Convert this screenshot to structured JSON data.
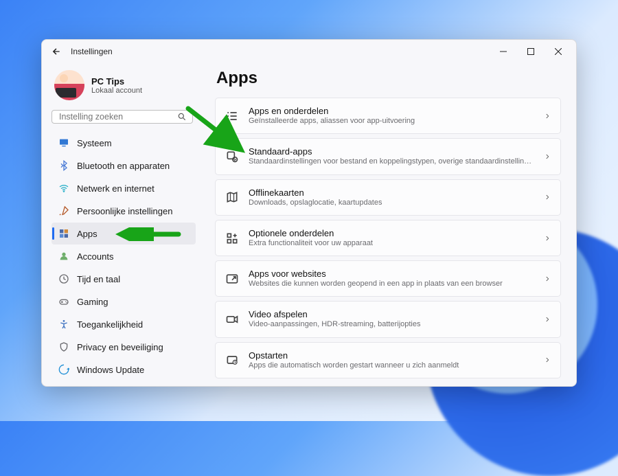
{
  "window": {
    "title": "Instellingen"
  },
  "profile": {
    "name": "PC Tips",
    "subtitle": "Lokaal account"
  },
  "search": {
    "placeholder": "Instelling zoeken"
  },
  "nav": {
    "items": [
      {
        "label": "Systeem",
        "icon": "monitor",
        "color": "#3178d4"
      },
      {
        "label": "Bluetooth en apparaten",
        "icon": "bluetooth",
        "color": "#4b7bd6"
      },
      {
        "label": "Netwerk en internet",
        "icon": "wifi",
        "color": "#2cb1c9"
      },
      {
        "label": "Persoonlijke instellingen",
        "icon": "brush",
        "color": "#b55a2a"
      },
      {
        "label": "Apps",
        "icon": "apps",
        "color": "#4c6aa6"
      },
      {
        "label": "Accounts",
        "icon": "person",
        "color": "#6fae6b"
      },
      {
        "label": "Tijd en taal",
        "icon": "clock",
        "color": "#6b6b6f"
      },
      {
        "label": "Gaming",
        "icon": "gamepad",
        "color": "#6b6b6f"
      },
      {
        "label": "Toegankelijkheid",
        "icon": "accessibility",
        "color": "#3a6fbf"
      },
      {
        "label": "Privacy en beveiliging",
        "icon": "shield",
        "color": "#6b6b6f"
      },
      {
        "label": "Windows Update",
        "icon": "update",
        "color": "#1f8fd6"
      }
    ],
    "active_index": 4
  },
  "page": {
    "title": "Apps",
    "cards": [
      {
        "title": "Apps en onderdelen",
        "subtitle": "Geïnstalleerde apps, aliassen voor app-uitvoering",
        "icon": "list"
      },
      {
        "title": "Standaard-apps",
        "subtitle": "Standaardinstellingen voor bestand en koppelingstypen, overige standaardinstellingen",
        "icon": "default"
      },
      {
        "title": "Offlinekaarten",
        "subtitle": "Downloads, opslaglocatie, kaartupdates",
        "icon": "map"
      },
      {
        "title": "Optionele onderdelen",
        "subtitle": "Extra functionaliteit voor uw apparaat",
        "icon": "add-grid"
      },
      {
        "title": "Apps voor websites",
        "subtitle": "Websites die kunnen worden geopend in een app in plaats van een browser",
        "icon": "link"
      },
      {
        "title": "Video afspelen",
        "subtitle": "Video-aanpassingen, HDR-streaming, batterijopties",
        "icon": "video"
      },
      {
        "title": "Opstarten",
        "subtitle": "Apps die automatisch worden gestart wanneer u zich aanmeldt",
        "icon": "startup"
      }
    ]
  },
  "annotations": {
    "arrow_to_card_index": 1,
    "arrow_to_nav_index": 4,
    "arrow_color": "#18a418"
  }
}
